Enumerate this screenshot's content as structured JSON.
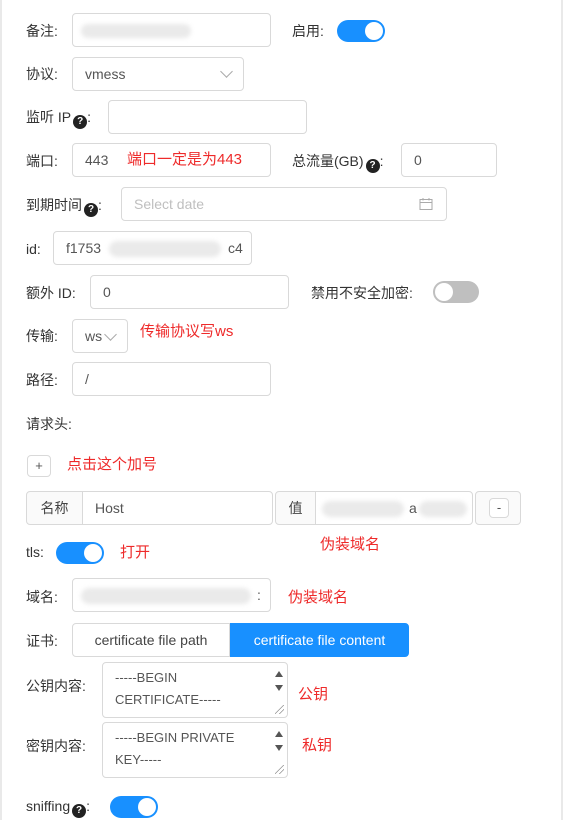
{
  "form": {
    "remark": {
      "label": "备注:"
    },
    "enable": {
      "label": "启用:",
      "on": true
    },
    "protocol": {
      "label": "协议:",
      "value": "vmess"
    },
    "listen_ip": {
      "label": "监听 IP",
      "colon": ":",
      "value": ""
    },
    "port": {
      "label": "端口:",
      "value": "443"
    },
    "total_traffic": {
      "label": "总流量(GB)",
      "colon": ":",
      "value": "0"
    },
    "expiry": {
      "label": "到期时间",
      "colon": ":",
      "placeholder": "Select date"
    },
    "id": {
      "label": "id:",
      "value_start": "f1753",
      "value_end": "c4"
    },
    "alter_id": {
      "label": "额外 ID:",
      "value": "0"
    },
    "disable_insecure": {
      "label": "禁用不安全加密:",
      "on": false
    },
    "transport": {
      "label": "传输:",
      "value": "ws"
    },
    "path": {
      "label": "路径:",
      "value": "/"
    },
    "headers": {
      "label": "请求头:",
      "add_button": "+"
    },
    "header_row": {
      "name_label": "名称",
      "name_value": "Host",
      "value_label": "值",
      "value_tail": "a",
      "remove_button": "-"
    },
    "tls": {
      "label": "tls:",
      "on": true
    },
    "domain": {
      "label": "域名:",
      "value_tail": ":"
    },
    "cert": {
      "label": "证书:",
      "options": [
        "certificate file path",
        "certificate file content"
      ],
      "selected": "certificate file content"
    },
    "public_key": {
      "label": "公钥内容:",
      "value": "-----BEGIN CERTIFICATE-----"
    },
    "private_key": {
      "label": "密钥内容:",
      "value": "-----BEGIN PRIVATE KEY-----"
    },
    "sniffing": {
      "label": "sniffing",
      "colon": ":",
      "on": true
    }
  },
  "annotations": {
    "port_note": "端口一定是为443",
    "transport_note": "传输协议写ws",
    "add_note": "点击这个加号",
    "host_note": "伪装域名",
    "tls_note": "打开",
    "domain_note": "伪装域名",
    "pubkey_note": "公钥",
    "privkey_note": "私钥"
  },
  "icons": {
    "help": "question-circle-icon",
    "calendar": "calendar-icon",
    "chevron": "chevron-down-icon"
  },
  "colors": {
    "primary": "#1890ff",
    "annotation": "#ee2a2a",
    "toggle_off": "#bfbfbf"
  }
}
